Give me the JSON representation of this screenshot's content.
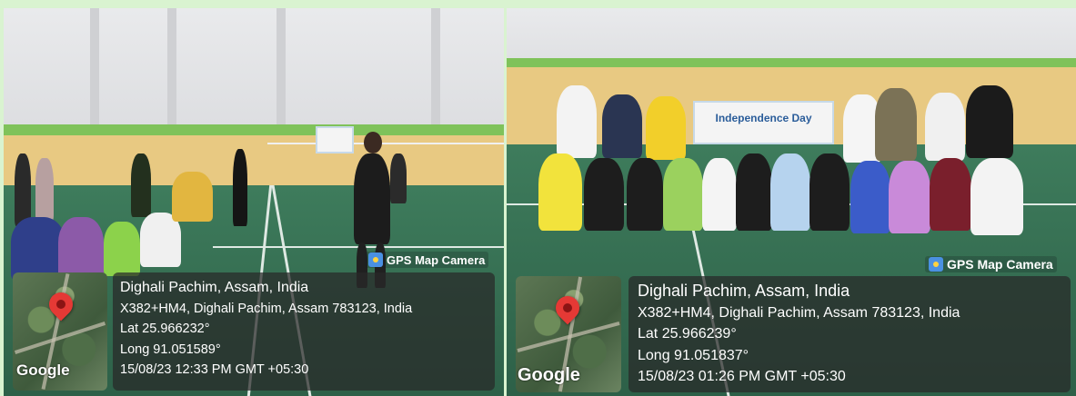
{
  "left_photo": {
    "gps_label": "GPS Map Camera",
    "place": "Dighali Pachim, Assam, India",
    "address": "X382+HM4, Dighali Pachim, Assam 783123, India",
    "lat": "Lat 25.966232°",
    "long": "Long 91.051589°",
    "datetime": "15/08/23 12:33 PM GMT +05:30",
    "map_brand": "Google"
  },
  "right_photo": {
    "gps_label": "GPS Map Camera",
    "place": "Dighali Pachim, Assam, India",
    "address": "X382+HM4, Dighali Pachim, Assam 783123, India",
    "lat": "Lat 25.966239°",
    "long": "Long 91.051837°",
    "datetime": "15/08/23 01:26 PM GMT +05:30",
    "map_brand": "Google",
    "banner_text": "Independence Day"
  },
  "colors": {
    "page_background": "#d9f3d0",
    "wall_band": "#7fc25a",
    "court_floor": "#3e7c5c",
    "pin": "#e53935",
    "overlay": "rgba(40,40,40,0.72)"
  },
  "icons": [
    "map-pin-icon",
    "gps-camera-icon"
  ]
}
